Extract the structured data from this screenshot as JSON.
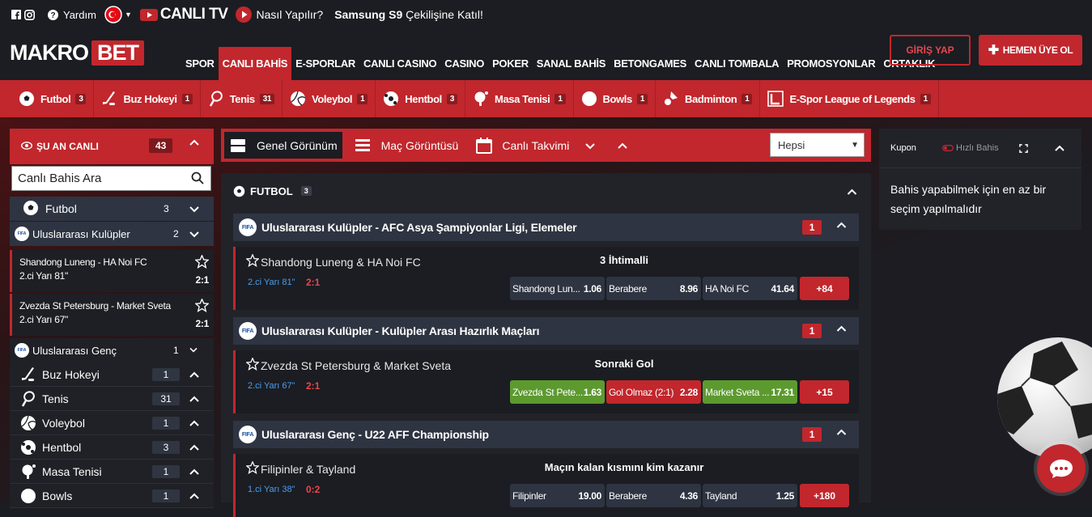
{
  "topbar": {
    "help": "Yardım",
    "live_tv": "CANLI TV",
    "how_to": "Nasıl Yapılır?",
    "promo_bold": "Samsung S9",
    "promo_rest": " Çekilişine Katıl!"
  },
  "header": {
    "logo_left": "MAKRO",
    "logo_right": "BET",
    "login": "GİRİŞ YAP",
    "register": "HEMEN ÜYE OL",
    "nav": [
      "SPOR",
      "CANLI BAHİS",
      "E-SPORLAR",
      "CANLI CASINO",
      "CASINO",
      "POKER",
      "SANAL BAHİS",
      "BETONGAMES",
      "CANLI TOMBALA",
      "PROMOSYONLAR",
      "ORTAKLIK"
    ]
  },
  "sportbar": [
    {
      "label": "Futbol",
      "count": "3"
    },
    {
      "label": "Buz Hokeyi",
      "count": "1"
    },
    {
      "label": "Tenis",
      "count": "31"
    },
    {
      "label": "Voleybol",
      "count": "1"
    },
    {
      "label": "Hentbol",
      "count": "3"
    },
    {
      "label": "Masa Tenisi",
      "count": "1"
    },
    {
      "label": "Bowls",
      "count": "1"
    },
    {
      "label": "Badminton",
      "count": "1"
    },
    {
      "label": "E-Spor League of Legends",
      "count": "1"
    }
  ],
  "left": {
    "live_title": "ŞU AN CANLI",
    "live_count": "43",
    "search_placeholder": "Canlı Bahis Ara",
    "futbol": {
      "label": "Futbol",
      "count": "3"
    },
    "clubs": {
      "label": "Uluslararası Kulüpler",
      "count": "2"
    },
    "match1": {
      "teams": "Shandong Luneng - HA Noi FC",
      "time": "2.ci Yarı 81\"",
      "score": "2:1"
    },
    "match2": {
      "teams": "Zvezda St Petersburg - Market Sveta",
      "time": "2.ci Yarı 67\"",
      "score": "2:1"
    },
    "youth": {
      "label": "Uluslararası Genç",
      "count": "1"
    },
    "sports": [
      {
        "label": "Buz Hokeyi",
        "count": "1"
      },
      {
        "label": "Tenis",
        "count": "31"
      },
      {
        "label": "Voleybol",
        "count": "1"
      },
      {
        "label": "Hentbol",
        "count": "3"
      },
      {
        "label": "Masa Tenisi",
        "count": "1"
      },
      {
        "label": "Bowls",
        "count": "1"
      }
    ]
  },
  "views": {
    "general": "Genel Görünüm",
    "match": "Maç Görüntüsü",
    "calendar": "Canlı Takvimi",
    "filter": "Hepsi"
  },
  "panel": {
    "title": "FUTBOL",
    "count": "3",
    "leagues": [
      {
        "name": "Uluslararası Kulüpler - AFC Asya Şampiyonlar Ligi, Elemeler",
        "count": "1",
        "match": "Shandong Luneng & HA Noi FC",
        "time": "2.ci Yarı 81\"",
        "score": "2:1",
        "market": "3 İhtimalli",
        "odds": [
          {
            "label": "Shandong Lun...",
            "value": "1.06"
          },
          {
            "label": "Berabere",
            "value": "8.96"
          },
          {
            "label": "HA Noi FC",
            "value": "41.64"
          }
        ],
        "more": "+84"
      },
      {
        "name": "Uluslararası Kulüpler - Kulüpler Arası Hazırlık Maçları",
        "count": "1",
        "match": "Zvezda St Petersburg & Market Sveta",
        "time": "2.ci Yarı 67\"",
        "score": "2:1",
        "market": "Sonraki Gol",
        "odds": [
          {
            "label": "Zvezda St Pete...",
            "value": "1.63"
          },
          {
            "label": "Gol Olmaz (2:1)",
            "value": "2.28"
          },
          {
            "label": "Market Sveta ...",
            "value": "17.31"
          }
        ],
        "more": "+15"
      },
      {
        "name": "Uluslararası Genç - U22 AFF Championship",
        "count": "1",
        "match": "Filipinler & Tayland",
        "time": "1.ci Yarı 38\"",
        "score": "0:2",
        "market": "Maçın kalan kısmını kim kazanır",
        "odds": [
          {
            "label": "Filipinler",
            "value": "19.00"
          },
          {
            "label": "Berabere",
            "value": "4.36"
          },
          {
            "label": "Tayland",
            "value": "1.25"
          }
        ],
        "more": "+180"
      }
    ]
  },
  "coupon": {
    "tab1": "Kupon",
    "tab2": "Hızlı Bahis",
    "message": "Bahis yapabilmek için en az bir seçim yapılmalıdır"
  },
  "colors": {
    "accent": "#c1272d",
    "dark": "#1b1d22",
    "green": "#5c9a2f",
    "link": "#4a9df0"
  }
}
